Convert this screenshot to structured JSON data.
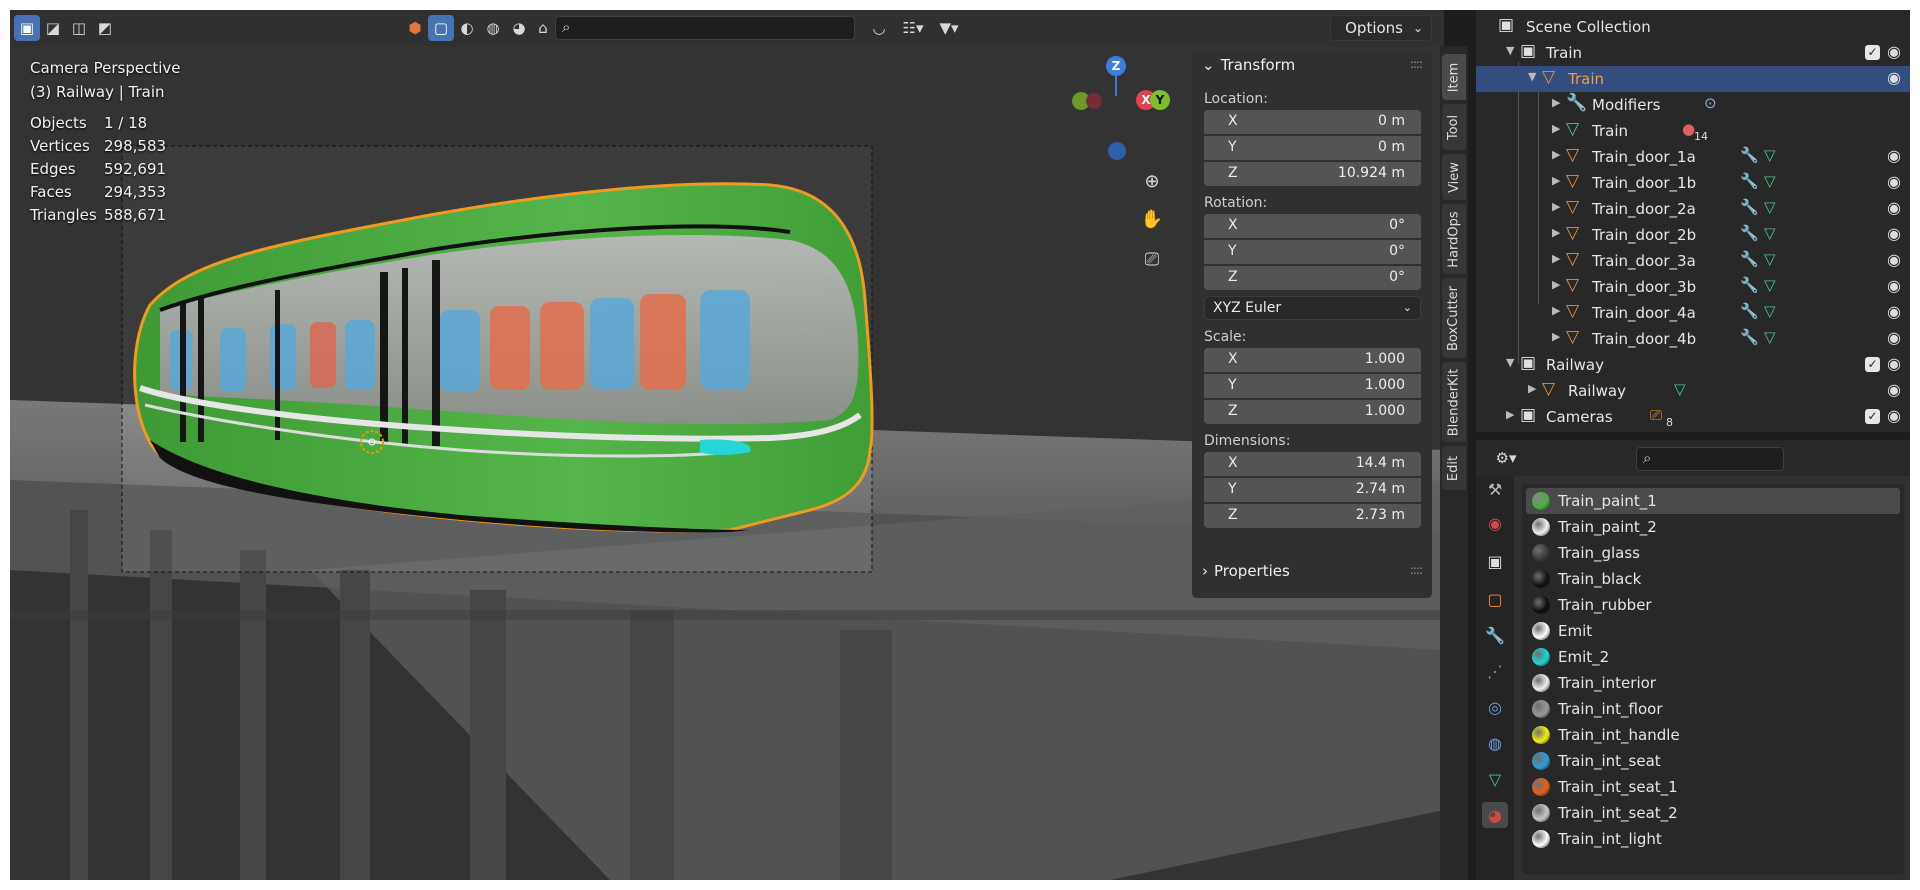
{
  "viewport": {
    "header": {
      "mode_icons": [
        "select-box-icon",
        "select-extend-icon",
        "select-subtract-icon",
        "select-intersect-icon"
      ],
      "shading_icons": [
        "material-icon",
        "wireframe-icon",
        "solid-icon",
        "lookdev-icon",
        "rendered-icon",
        "xray-icon"
      ],
      "search_placeholder": "",
      "options_label": "Options"
    },
    "overlay": {
      "camera": "Camera Perspective",
      "context": "(3) Railway | Train",
      "stats": [
        {
          "label": "Objects",
          "value": "1 / 18"
        },
        {
          "label": "Vertices",
          "value": "298,583"
        },
        {
          "label": "Edges",
          "value": "592,691"
        },
        {
          "label": "Faces",
          "value": "294,353"
        },
        {
          "label": "Triangles",
          "value": "588,671"
        }
      ]
    },
    "gizmo": {
      "z": "Z",
      "x": "X",
      "y": "Y"
    }
  },
  "npanel": {
    "transform_title": "Transform",
    "location_label": "Location:",
    "location": [
      {
        "axis": "X",
        "value": "0 m"
      },
      {
        "axis": "Y",
        "value": "0 m"
      },
      {
        "axis": "Z",
        "value": "10.924 m"
      }
    ],
    "rotation_label": "Rotation:",
    "rotation": [
      {
        "axis": "X",
        "value": "0°"
      },
      {
        "axis": "Y",
        "value": "0°"
      },
      {
        "axis": "Z",
        "value": "0°"
      }
    ],
    "rotation_mode": "XYZ Euler",
    "scale_label": "Scale:",
    "scale": [
      {
        "axis": "X",
        "value": "1.000"
      },
      {
        "axis": "Y",
        "value": "1.000"
      },
      {
        "axis": "Z",
        "value": "1.000"
      }
    ],
    "dimensions_label": "Dimensions:",
    "dimensions": [
      {
        "axis": "X",
        "value": "14.4 m"
      },
      {
        "axis": "Y",
        "value": "2.74 m"
      },
      {
        "axis": "Z",
        "value": "2.73 m"
      }
    ],
    "properties_title": "Properties"
  },
  "sidetabs": [
    "Item",
    "Tool",
    "View",
    "HardOps",
    "BoxCutter",
    "BlenderKit",
    "Edit"
  ],
  "outliner": {
    "root": "Scene Collection",
    "items": [
      {
        "name": "Train",
        "type": "collection"
      },
      {
        "name": "Train",
        "type": "object"
      },
      {
        "name": "Modifiers",
        "type": "modifiers"
      },
      {
        "name": "Train",
        "type": "mesh",
        "badge": "14"
      },
      {
        "name": "Train_door_1a",
        "type": "object"
      },
      {
        "name": "Train_door_1b",
        "type": "object"
      },
      {
        "name": "Train_door_2a",
        "type": "object"
      },
      {
        "name": "Train_door_2b",
        "type": "object"
      },
      {
        "name": "Train_door_3a",
        "type": "object"
      },
      {
        "name": "Train_door_3b",
        "type": "object"
      },
      {
        "name": "Train_door_4a",
        "type": "object"
      },
      {
        "name": "Train_door_4b",
        "type": "object"
      },
      {
        "name": "Railway",
        "type": "collection"
      },
      {
        "name": "Railway",
        "type": "object"
      },
      {
        "name": "Cameras",
        "type": "collection",
        "badge": "8"
      }
    ]
  },
  "properties": {
    "search_placeholder": "",
    "materials": [
      {
        "name": "Train_paint_1",
        "color": "#4caf3f"
      },
      {
        "name": "Train_paint_2",
        "color": "#f2f2f2"
      },
      {
        "name": "Train_glass",
        "color": "#3a3a3a"
      },
      {
        "name": "Train_black",
        "color": "#111111"
      },
      {
        "name": "Train_rubber",
        "color": "#0d0d0d"
      },
      {
        "name": "Emit",
        "color": "#ffffff"
      },
      {
        "name": "Emit_2",
        "color": "#19d7d7"
      },
      {
        "name": "Train_interior",
        "color": "#f0f0f0"
      },
      {
        "name": "Train_int_floor",
        "color": "#9a9a9a"
      },
      {
        "name": "Train_int_handle",
        "color": "#f2f20a"
      },
      {
        "name": "Train_int_seat",
        "color": "#2a9fd8"
      },
      {
        "name": "Train_int_seat_1",
        "color": "#e85d18"
      },
      {
        "name": "Train_int_seat_2",
        "color": "#c8c8c8"
      },
      {
        "name": "Train_int_light",
        "color": "#ffffff"
      }
    ]
  },
  "colors": {
    "accent": "#4772b3",
    "selection": "#334d80",
    "object_orange": "#e8913a",
    "mesh_green": "#49c98a"
  }
}
